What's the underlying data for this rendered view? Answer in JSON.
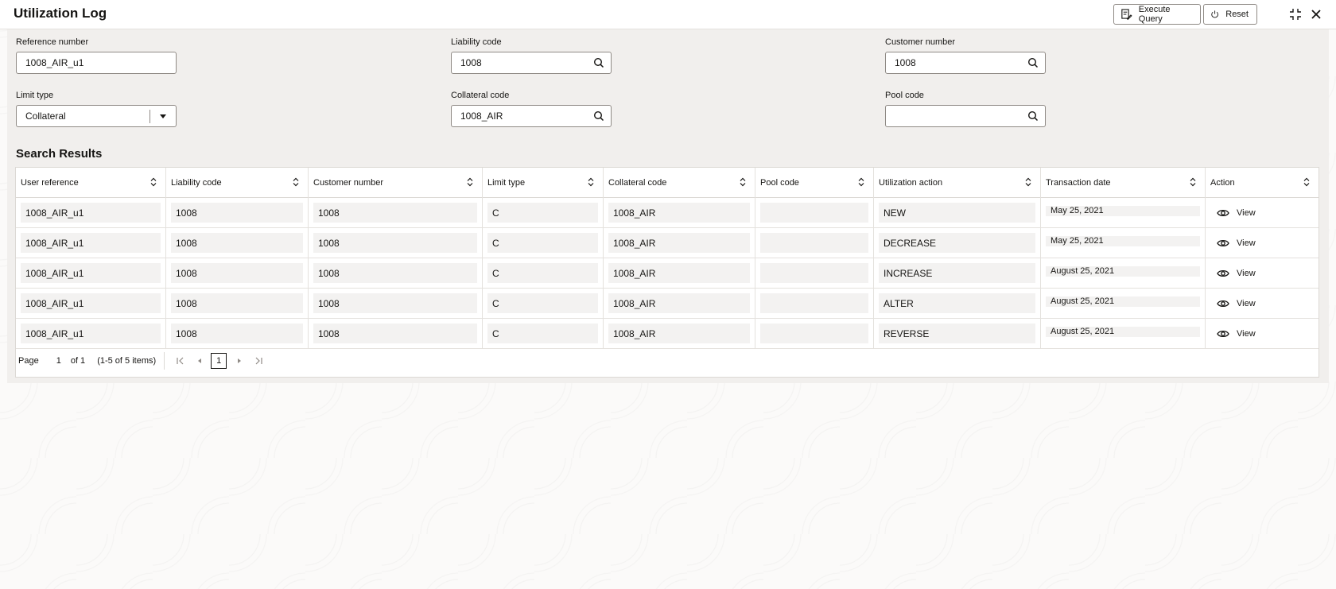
{
  "window": {
    "title": "Utilization Log",
    "execute_query_label": "Execute Query",
    "reset_label": "Reset"
  },
  "form": {
    "reference_number": {
      "label": "Reference number",
      "value": "1008_AIR_u1"
    },
    "liability_code": {
      "label": "Liability code",
      "value": "1008"
    },
    "customer_number": {
      "label": "Customer number",
      "value": "1008"
    },
    "limit_type": {
      "label": "Limit type",
      "value": "Collateral"
    },
    "collateral_code": {
      "label": "Collateral code",
      "value": "1008_AIR"
    },
    "pool_code": {
      "label": "Pool code",
      "value": ""
    }
  },
  "results": {
    "title": "Search Results",
    "columns": [
      "User reference",
      "Liability code",
      "Customer number",
      "Limit type",
      "Collateral code",
      "Pool code",
      "Utilization action",
      "Transaction date",
      "Action"
    ],
    "rows": [
      {
        "user_reference": "1008_AIR_u1",
        "liability_code": "1008",
        "customer_number": "1008",
        "limit_type": "C",
        "collateral_code": "1008_AIR",
        "pool_code": "",
        "utilization_action": "NEW",
        "transaction_date": "May 25, 2021",
        "action": "View"
      },
      {
        "user_reference": "1008_AIR_u1",
        "liability_code": "1008",
        "customer_number": "1008",
        "limit_type": "C",
        "collateral_code": "1008_AIR",
        "pool_code": "",
        "utilization_action": "DECREASE",
        "transaction_date": "May 25, 2021",
        "action": "View"
      },
      {
        "user_reference": "1008_AIR_u1",
        "liability_code": "1008",
        "customer_number": "1008",
        "limit_type": "C",
        "collateral_code": "1008_AIR",
        "pool_code": "",
        "utilization_action": "INCREASE",
        "transaction_date": "August 25, 2021",
        "action": "View"
      },
      {
        "user_reference": "1008_AIR_u1",
        "liability_code": "1008",
        "customer_number": "1008",
        "limit_type": "C",
        "collateral_code": "1008_AIR",
        "pool_code": "",
        "utilization_action": "ALTER",
        "transaction_date": "August 25, 2021",
        "action": "View"
      },
      {
        "user_reference": "1008_AIR_u1",
        "liability_code": "1008",
        "customer_number": "1008",
        "limit_type": "C",
        "collateral_code": "1008_AIR",
        "pool_code": "",
        "utilization_action": "REVERSE",
        "transaction_date": "August 25, 2021",
        "action": "View"
      }
    ]
  },
  "pagination": {
    "page_label": "Page",
    "current_page": "1",
    "of_label": "of 1",
    "items_summary": "(1-5 of 5 items)",
    "page_button": "1"
  },
  "icons": {
    "execute": "execute-query-icon",
    "reset": "reset-icon",
    "minimize": "collapse-icon",
    "close": "close-icon",
    "search": "search-icon",
    "sort": "sort-icon",
    "view": "eye-icon"
  }
}
